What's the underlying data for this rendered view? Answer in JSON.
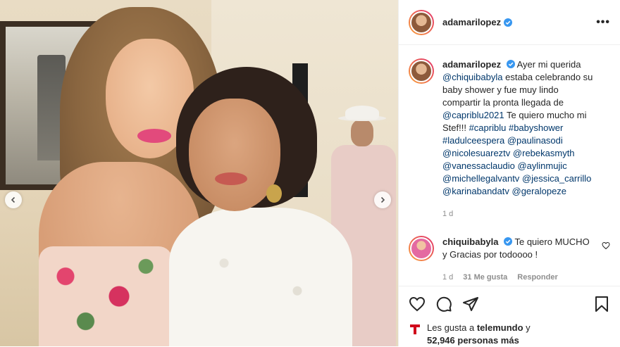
{
  "post": {
    "author": "adamarilopez",
    "caption_parts": [
      {
        "t": "Ayer mi querida ",
        "link": false
      },
      {
        "t": "@chiquibabyla",
        "link": true
      },
      {
        "t": " estaba celebrando su baby shower y fue muy lindo compartir la pronta llegada de ",
        "link": false
      },
      {
        "t": "@capriblu2021",
        "link": true
      },
      {
        "t": " Te quiero mucho mi Stef!!! ",
        "link": false
      },
      {
        "t": "#capriblu",
        "link": true
      },
      {
        "t": " ",
        "link": false
      },
      {
        "t": "#babyshower",
        "link": true
      },
      {
        "t": " ",
        "link": false
      },
      {
        "t": "#ladulceespera",
        "link": true
      },
      {
        "t": " ",
        "link": false
      },
      {
        "t": "@paulinasodi",
        "link": true
      },
      {
        "t": " ",
        "link": false
      },
      {
        "t": "@nicolesuareztv",
        "link": true
      },
      {
        "t": " ",
        "link": false
      },
      {
        "t": "@rebekasmyth",
        "link": true
      },
      {
        "t": " ",
        "link": false
      },
      {
        "t": "@vanessaclaudio",
        "link": true
      },
      {
        "t": " ",
        "link": false
      },
      {
        "t": "@aylinmujic",
        "link": true
      },
      {
        "t": " ",
        "link": false
      },
      {
        "t": "@michellegalvantv",
        "link": true
      },
      {
        "t": " ",
        "link": false
      },
      {
        "t": "@jessica_carrillo",
        "link": true
      },
      {
        "t": " ",
        "link": false
      },
      {
        "t": "@karinabandatv",
        "link": true
      },
      {
        "t": " ",
        "link": false
      },
      {
        "t": "@geralopeze",
        "link": true
      }
    ],
    "caption_time": "1 d"
  },
  "comment": {
    "author": "chiquibabyla",
    "text": "Te quiero MUCHO y Gracias por todoooo !",
    "time": "1 d",
    "likes": "31 Me gusta",
    "reply": "Responder"
  },
  "likes": {
    "prefix": "Les gusta a ",
    "first_user": "telemundo",
    "middle": " y",
    "count": "52,946 personas más"
  },
  "icons": {
    "more": "more-options-icon",
    "verified": "verified-badge-icon",
    "heart": "heart-icon",
    "comment": "comment-icon",
    "share": "share-icon",
    "save": "bookmark-icon",
    "prev": "chevron-left-icon",
    "next": "chevron-right-icon"
  },
  "colors": {
    "verified": "#3897f0",
    "link": "#00376b",
    "muted": "#8e8e8e",
    "telemundo": "#d0021b"
  }
}
